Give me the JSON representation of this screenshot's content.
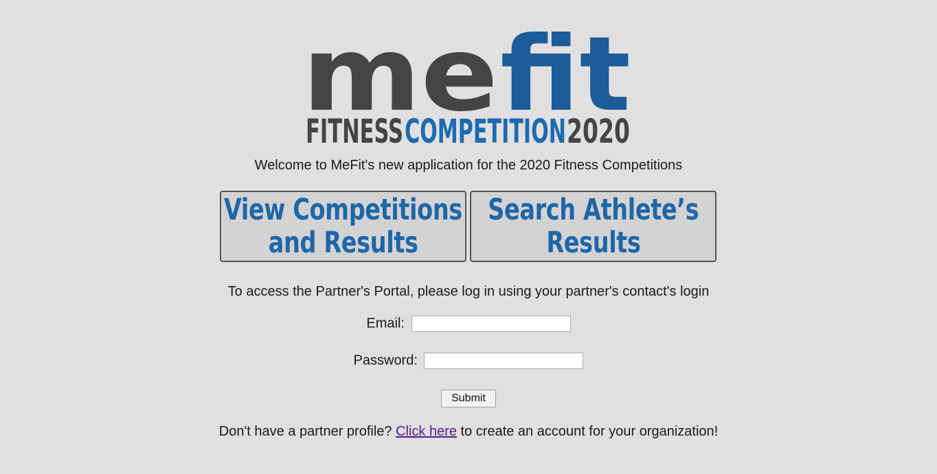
{
  "logo": {
    "word_dark": "me",
    "word_blue": "fit",
    "tag_dark": "FITNESS",
    "tag_blue": "COMPETITION",
    "tag_year": "2020",
    "colors": {
      "dark": "#444444",
      "blue": "#1d5b99",
      "tag_blue": "#1e6bb0"
    }
  },
  "welcome_text": "Welcome to MeFit's new application for the 2020 Fitness Competitions",
  "buttons": {
    "view": {
      "line1": "View Competitions",
      "line2": "and Results"
    },
    "search": {
      "line1": "Search Athlete’s",
      "line2": "Results"
    }
  },
  "portal_text": "To access the Partner's Portal, please log in using your partner's contact's login",
  "form": {
    "email_label": "Email:",
    "email_value": "",
    "password_label": "Password:",
    "password_value": "",
    "submit_label": "Submit"
  },
  "footer": {
    "before": "Don't have a partner profile? ",
    "link": "Click here",
    "after": " to create an account for your organization!"
  },
  "colors": {
    "background": "#e0e0e0",
    "button_text": "#1e66a8",
    "link_visited": "#551a8b"
  }
}
